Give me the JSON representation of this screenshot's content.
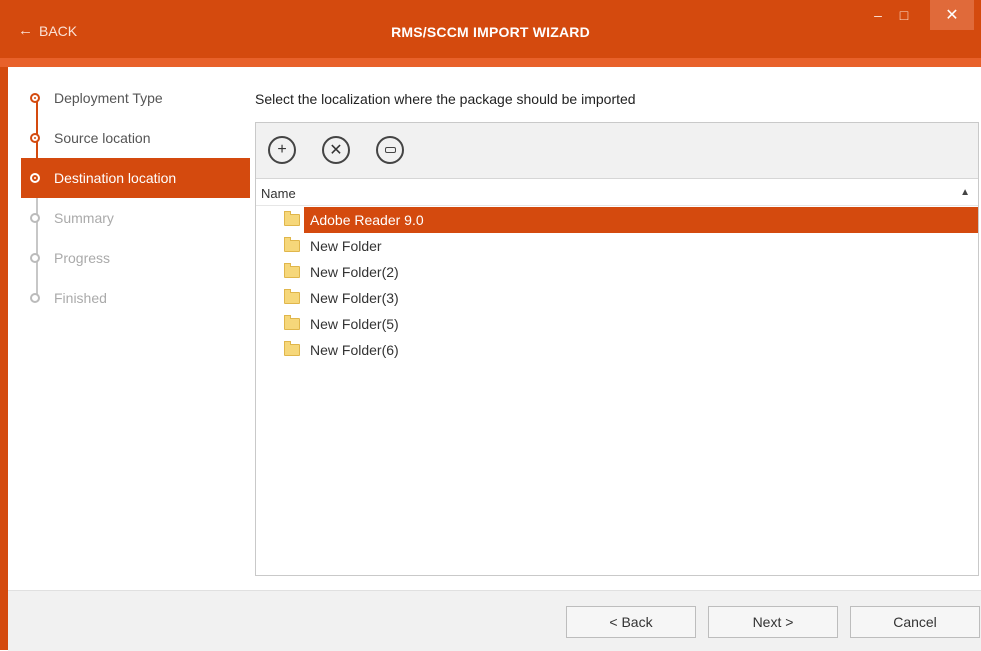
{
  "window": {
    "title": "RMS/SCCM IMPORT WIZARD",
    "back_label": "BACK",
    "minimize": "–",
    "maximize": "□",
    "close": "✕"
  },
  "steps": [
    {
      "label": "Deployment Type",
      "state": "done"
    },
    {
      "label": "Source location",
      "state": "done"
    },
    {
      "label": "Destination location",
      "state": "active"
    },
    {
      "label": "Summary",
      "state": "future"
    },
    {
      "label": "Progress",
      "state": "future"
    },
    {
      "label": "Finished",
      "state": "future"
    }
  ],
  "main": {
    "instruction": "Select the localization where the package should be imported",
    "column_name": "Name",
    "sort_indicator": "▲",
    "folders": [
      {
        "name": "Adobe Reader 9.0",
        "selected": true
      },
      {
        "name": "New Folder",
        "selected": false
      },
      {
        "name": "New Folder(2)",
        "selected": false
      },
      {
        "name": "New Folder(3)",
        "selected": false
      },
      {
        "name": "New Folder(5)",
        "selected": false
      },
      {
        "name": "New Folder(6)",
        "selected": false
      }
    ]
  },
  "toolbar": {
    "add_icon": "plus-circle-icon",
    "delete_icon": "x-circle-icon",
    "other_icon": "rename-icon"
  },
  "footer": {
    "back_label": "< Back",
    "next_label": "Next >",
    "cancel_label": "Cancel"
  },
  "colors": {
    "accent": "#d44a0e",
    "accent_light": "#e8612a"
  }
}
